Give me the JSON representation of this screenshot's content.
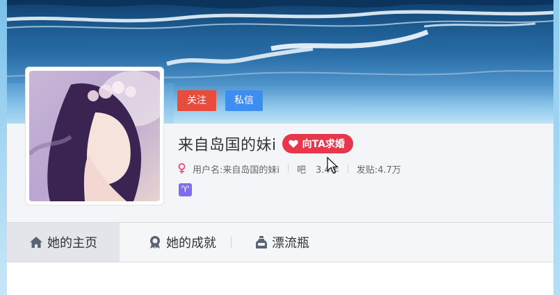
{
  "profile": {
    "follow_label": "关注",
    "message_label": "私信",
    "name": "来自岛国的妹i",
    "propose_label": "向TA求婚",
    "username_text": "用户名:来自岛国的妹i",
    "ba_age_text": "吧",
    "ba_age_value": "3.4年",
    "posts_text": "发贴:4.7万",
    "zodiac_symbol": "♈"
  },
  "tabs": [
    {
      "label": "她的主页",
      "icon": "home-icon"
    },
    {
      "label": "她的成就",
      "icon": "achievement-icon"
    },
    {
      "label": "漂流瓶",
      "icon": "bottle-icon"
    }
  ],
  "colors": {
    "follow": "#e74c3c",
    "message": "#3d8ef0",
    "propose": "#e8364d",
    "zodiac": "#7b6cf0",
    "female": "#e75a7c"
  }
}
